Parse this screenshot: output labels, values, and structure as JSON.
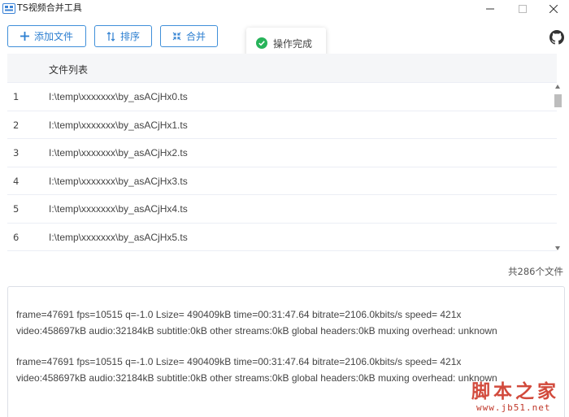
{
  "window": {
    "title": "TS视频合并工具"
  },
  "toolbar": {
    "add_label": "添加文件",
    "sort_label": "排序",
    "merge_label": "合并"
  },
  "toast": {
    "text": "操作完成"
  },
  "table": {
    "header": "文件列表",
    "rows": [
      {
        "index": "1",
        "path": "I:\\temp\\xxxxxxx\\by_asACjHx0.ts"
      },
      {
        "index": "2",
        "path": "I:\\temp\\xxxxxxx\\by_asACjHx1.ts"
      },
      {
        "index": "3",
        "path": "I:\\temp\\xxxxxxx\\by_asACjHx2.ts"
      },
      {
        "index": "4",
        "path": "I:\\temp\\xxxxxxx\\by_asACjHx3.ts"
      },
      {
        "index": "5",
        "path": "I:\\temp\\xxxxxxx\\by_asACjHx4.ts"
      },
      {
        "index": "6",
        "path": "I:\\temp\\xxxxxxx\\by_asACjHx5.ts"
      }
    ]
  },
  "file_count": "共286个文件",
  "log": {
    "lines": [
      "frame=47691 fps=10515 q=-1.0 Lsize=  490409kB time=00:31:47.64 bitrate=2106.0kbits/s speed= 421x",
      "video:458697kB audio:32184kB subtitle:0kB other streams:0kB global headers:0kB muxing overhead: unknown",
      "frame=47691 fps=10515 q=-1.0 Lsize=  490409kB time=00:31:47.64 bitrate=2106.0kbits/s speed= 421x",
      "video:458697kB audio:32184kB subtitle:0kB other streams:0kB global headers:0kB muxing overhead: unknown"
    ]
  },
  "watermark": {
    "name": "脚本之家",
    "url": "www.jb51.net"
  },
  "colors": {
    "accent": "#2d7fd1",
    "success": "#27b35a",
    "watermark": "#d24a3c"
  },
  "icons": {
    "app": "app-icon",
    "minimize": "minimize-icon",
    "maximize": "maximize-icon",
    "close": "close-icon",
    "add": "plus-icon",
    "sort": "sort-icon",
    "merge": "merge-icon",
    "toast": "check-circle-icon",
    "github": "github-icon"
  }
}
